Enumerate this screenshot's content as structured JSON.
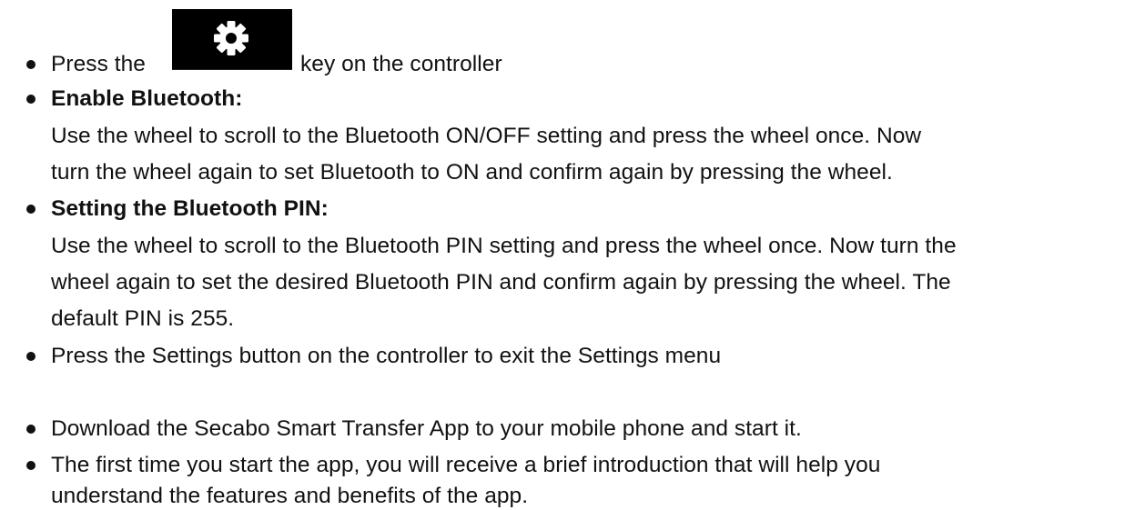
{
  "items": [
    {
      "prefix": "Press the",
      "suffix": "key on the controller",
      "icon": "gear-icon"
    },
    {
      "heading": "Enable Bluetooth:",
      "lines": [
        "Use the wheel to scroll to the Bluetooth ON/OFF setting and press the wheel once. Now",
        "turn the wheel again to set Bluetooth to ON and confirm again by pressing the wheel."
      ]
    },
    {
      "heading": "Setting the Bluetooth PIN:",
      "lines": [
        "Use the wheel to scroll to the Bluetooth PIN setting and press the wheel once. Now turn the",
        "wheel again to set the desired Bluetooth PIN and confirm again by pressing the wheel. The",
        "default PIN is 255."
      ]
    },
    {
      "text": "Press the Settings button on the controller to exit the Settings menu"
    },
    {
      "text": "Download the Secabo Smart Transfer App to your mobile phone and start it."
    },
    {
      "lines": [
        "The first time you start the app, you will receive a brief introduction that will help you",
        "understand the features and benefits of the app."
      ]
    }
  ]
}
